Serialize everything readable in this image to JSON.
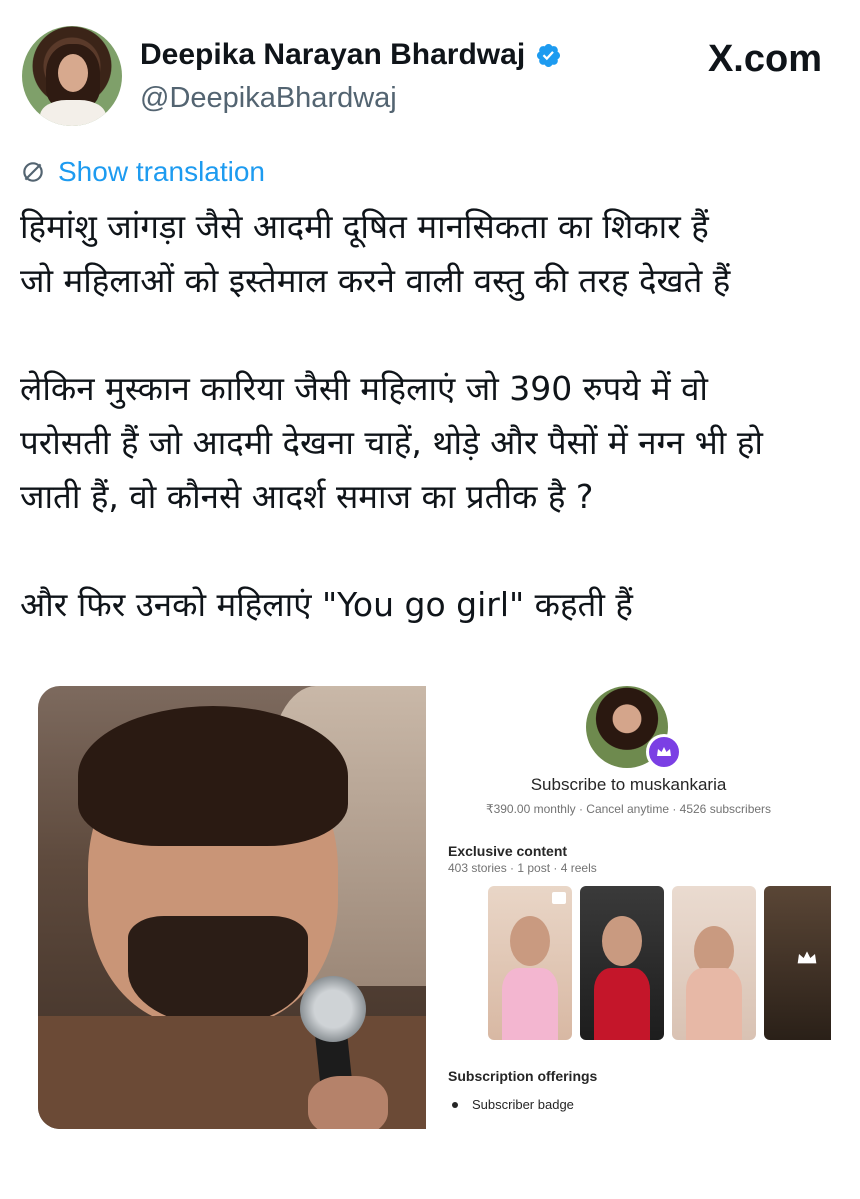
{
  "author": {
    "name": "Deepika Narayan Bhardwaj",
    "handle": "@DeepikaBhardwaj",
    "verified": true
  },
  "brand": "X.com",
  "translate_label": "Show translation",
  "tweet": {
    "paragraphs": [
      [
        "हिमांशु जांगड़ा जैसे आदमी दूषित मानसिकता का शिकार हैं",
        "जो महिलाओं को इस्तेमाल करने वाली वस्तु की तरह देखते हैं"
      ],
      [
        "लेकिन मुस्कान कारिया जैसी महिलाएं जो 390 रुपये में वो",
        "परोसती हैं जो आदमी देखना चाहें, थोड़े और पैसों में नग्न भी हो",
        "जाती हैं, वो कौनसे आदर्श समाज का प्रतीक है ?"
      ],
      [
        "और फिर उनको महिलाएं \"You go girl\" कहती हैं"
      ]
    ]
  },
  "subscription_card": {
    "title": "Subscribe to muskankaria",
    "meta": "₹390.00 monthly · Cancel anytime · 4526 subscribers",
    "exclusive_title": "Exclusive content",
    "exclusive_meta": "403 stories · 1 post · 4 reels",
    "offerings_title": "Subscription offerings",
    "offerings": [
      "Subscriber badge"
    ]
  },
  "colors": {
    "link": "#1d9bf0",
    "verified": "#1d9bf0",
    "text": "#0f1419",
    "secondary": "#536471",
    "crown_badge": "#7b3fe4"
  },
  "icons": {
    "verified": "verified-badge-icon",
    "translate": "globe-translate-icon",
    "crown": "crown-icon",
    "play": "reel-play-icon"
  }
}
